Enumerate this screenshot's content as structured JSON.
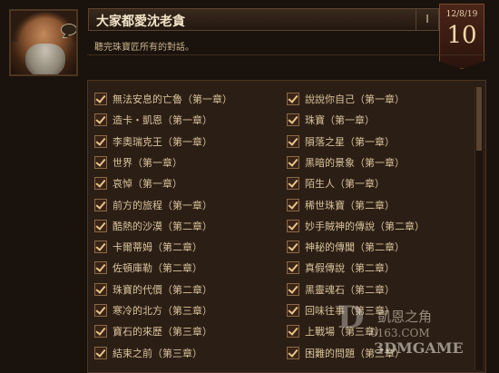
{
  "header": {
    "title": "大家都愛沈老貪",
    "subtitle": "聽完珠寶匠所有的對話。",
    "collapse_label": "I"
  },
  "banner": {
    "date": "12/8/19",
    "day": "10"
  },
  "achievements": {
    "left": [
      "無法安息的亡魯（第一章）",
      "造卡・凱恩（第一章）",
      "李奧瑞克王（第一章）",
      "世界（第一章）",
      "哀悼（第一章）",
      "前方的旅程（第一章）",
      "酷熱的沙漠（第二章）",
      "卡爾蒂姆（第二章）",
      "佐頓庫勒（第二章）",
      "珠寶的代價（第二章）",
      "寒冷的北方（第三章）",
      "寶石的來歷（第三章）",
      "結束之前（第三章）"
    ],
    "right": [
      "說說你自己（第一章）",
      "珠寶（第一章）",
      "隕落之星（第一章）",
      "黑暗的景象（第一章）",
      "陌生人（第一章）",
      "稀世珠寶（第二章）",
      "妙手賊神的傳說（第二章）",
      "神秘的傳聞（第二章）",
      "真假傳說（第二章）",
      "黑靈魂石（第二章）",
      "回味往事（第三章）",
      "上戰場（第三章）",
      "困難的問題（第三章）"
    ]
  },
  "watermark": {
    "mark": "D",
    "line1": "凱恩之角",
    "line2": "0163.COM",
    "line3": "3DMGAME"
  },
  "colors": {
    "background": "#1a120c",
    "panel": "#2b1e15",
    "text": "#d8c39b",
    "check": "#e9c48a"
  }
}
